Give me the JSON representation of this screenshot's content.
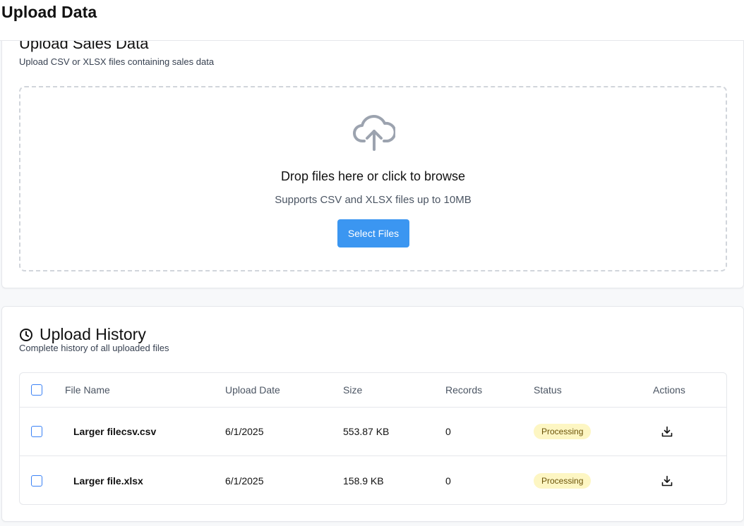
{
  "header": {
    "title": "Upload Data"
  },
  "upload": {
    "title": "Upload Sales Data",
    "description": "Upload CSV or XLSX files containing sales data",
    "drop_title": "Drop files here or click to browse",
    "drop_subtitle": "Supports CSV and XLSX files up to 10MB",
    "select_button": "Select Files",
    "icon": "cloud-upload-icon"
  },
  "history": {
    "title": "Upload History",
    "description": "Complete history of all uploaded files",
    "icon": "clock-icon",
    "columns": [
      "File Name",
      "Upload Date",
      "Size",
      "Records",
      "Status",
      "Actions"
    ],
    "rows": [
      {
        "file_name": "Larger filecsv.csv",
        "upload_date": "6/1/2025",
        "size": "553.87 KB",
        "records": "0",
        "status": "Processing",
        "action_icon": "download-icon"
      },
      {
        "file_name": "Larger file.xlsx",
        "upload_date": "6/1/2025",
        "size": "158.9 KB",
        "records": "0",
        "status": "Processing",
        "action_icon": "download-icon"
      }
    ]
  },
  "colors": {
    "primary": "#3b96f1",
    "status_processing_bg": "#fdf6c3",
    "status_processing_text": "#6b5308"
  }
}
